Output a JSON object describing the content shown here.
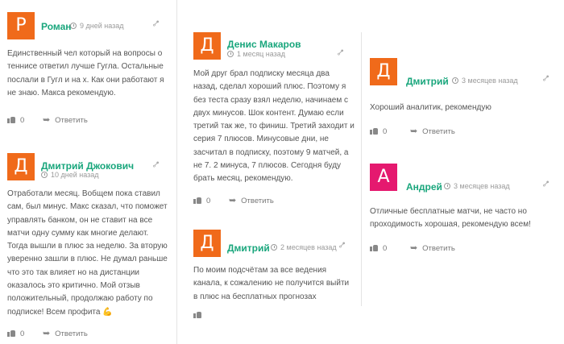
{
  "reviews": [
    {
      "avatar_letter": "Р",
      "avatar_color": "#f06a1a",
      "author": "Роман",
      "time": "9 дней назад",
      "text": "Единственный чел который на вопросы о теннисе ответил лучше Гугла. Остальные послали в Гугл и на х. Как они работают я не знаю. Макса рекомендую.",
      "likes": "0",
      "reply": "Ответить"
    },
    {
      "avatar_letter": "Д",
      "avatar_color": "#f06a1a",
      "author": "Дмитрий Джокович",
      "time": "10 дней назад",
      "text": "Отработали месяц. Вобщем пока ставил сам, был минус. Макс сказал, что поможет управлять банком, он не ставит на все матчи одну сумму как многие делают. Тогда вышли в плюс за неделю. За вторую уверенно зашли в плюс. Не думал раньше что это так влияет но на дистанции оказалось это критично. Мой отзыв положительный, продолжаю работу по подписке! Всем профита 💪",
      "likes": "0",
      "reply": "Ответить"
    },
    {
      "avatar_letter": "Д",
      "avatar_color": "#f06a1a",
      "author": "Денис Макаров",
      "time": "1 месяц назад",
      "text": "Мой друг брал подписку месяца два назад, сделал хороший плюс. Поэтому я без теста сразу взял неделю, начинаем с двух минусов. Шок контент. Думаю если третий так же, то финиш. Третий заходит и серия 7 плюсов. Минусовые дни, не засчитал в подписку, поэтому 9 матчей, а не 7. 2 минуса, 7 плюсов. Сегодня буду брать месяц, рекомендую.",
      "likes": "0",
      "reply": "Ответить"
    },
    {
      "avatar_letter": "Д",
      "avatar_color": "#f06a1a",
      "author": "Дмитрий",
      "time": "2 месяцев назад",
      "text": "По моим подсчётам за все ведения канала, к сожалению не получится выйти в плюс на бесплатных прогнозах",
      "likes": "",
      "reply": ""
    },
    {
      "avatar_letter": "Д",
      "avatar_color": "#f06a1a",
      "author": "Дмитрий",
      "time": "3 месяцев назад",
      "text": "Хороший аналитик, рекомендую",
      "likes": "0",
      "reply": "Ответить"
    },
    {
      "avatar_letter": "А",
      "avatar_color": "#e5196f",
      "author": "Андрей",
      "time": "3 месяцев назад",
      "text": "Отличные бесплатные матчи, не часто но проходимость хорошая, рекомендую всем!",
      "likes": "0",
      "reply": "Ответить"
    }
  ]
}
